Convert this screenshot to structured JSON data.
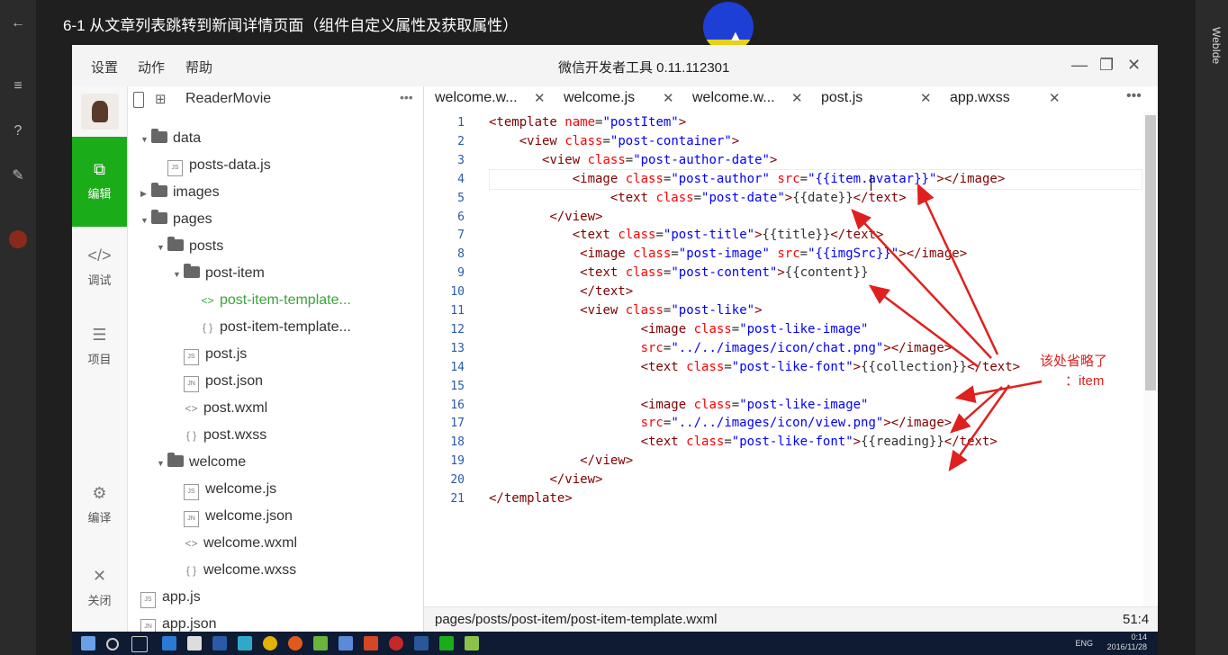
{
  "video": {
    "title": "6-1 从文章列表跳转到新闻详情页面（组件自定义属性及获取属性）",
    "right_panel_label": "WebIde"
  },
  "menubar": {
    "items": [
      "设置",
      "动作",
      "帮助"
    ],
    "window_title": "微信开发者工具 0.11.112301",
    "controls": [
      "—",
      "❐",
      "✕"
    ]
  },
  "iconbar": {
    "items": [
      {
        "icon": "edit-icon",
        "glyph": "⧉",
        "label": "编辑"
      },
      {
        "icon": "debug-icon",
        "glyph": "</>",
        "label": "调试"
      },
      {
        "icon": "project-icon",
        "glyph": "☰",
        "label": "项目"
      },
      {
        "icon": "compile-icon",
        "glyph": "⚙",
        "label": "编译"
      },
      {
        "icon": "close-icon",
        "glyph": "✕",
        "label": "关闭"
      }
    ]
  },
  "tree": {
    "project": "ReaderMovie",
    "nodes": [
      {
        "type": "folder",
        "label": "data",
        "open": true
      },
      {
        "type": "file",
        "tag": "JS",
        "label": "posts-data.js"
      },
      {
        "type": "folder",
        "label": "images",
        "open": false
      },
      {
        "type": "folder",
        "label": "pages",
        "open": true
      },
      {
        "type": "folder",
        "label": "posts",
        "open": true
      },
      {
        "type": "folder",
        "label": "post-item",
        "open": true
      },
      {
        "type": "wxml",
        "sym": "<>",
        "label": "post-item-template..."
      },
      {
        "type": "wxss",
        "sym": "{ }",
        "label": "post-item-template..."
      },
      {
        "type": "file",
        "tag": "JS",
        "label": "post.js"
      },
      {
        "type": "file",
        "tag": "JN",
        "label": "post.json"
      },
      {
        "type": "wxml",
        "sym": "<>",
        "label": "post.wxml"
      },
      {
        "type": "wxss",
        "sym": "{ }",
        "label": "post.wxss"
      },
      {
        "type": "folder",
        "label": "welcome",
        "open": true
      },
      {
        "type": "file",
        "tag": "JS",
        "label": "welcome.js"
      },
      {
        "type": "file",
        "tag": "JN",
        "label": "welcome.json"
      },
      {
        "type": "wxml",
        "sym": "<>",
        "label": "welcome.wxml"
      },
      {
        "type": "wxss",
        "sym": "{ }",
        "label": "welcome.wxss"
      },
      {
        "type": "file",
        "tag": "JS",
        "label": "app.js"
      },
      {
        "type": "file",
        "tag": "JN",
        "label": "app.json"
      }
    ]
  },
  "tabs": [
    "welcome.w...",
    "welcome.js",
    "welcome.w...",
    "post.js",
    "app.wxss"
  ],
  "code": [
    "<template name=\"postItem\">",
    "    <view class=\"post-container\">",
    "       <view class=\"post-author-date\">",
    "           <image class=\"post-author\" src=\"{{item.avatar}}\"></image>",
    "                <text class=\"post-date\">{{date}}</text>",
    "        </view>",
    "           <text class=\"post-title\">{{title}}</text>",
    "            <image class=\"post-image\" src=\"{{imgSrc}}\"></image>",
    "            <text class=\"post-content\">{{content}}",
    "            </text>",
    "            <view class=\"post-like\">",
    "                    <image class=\"post-like-image\"",
    "                    src=\"../../images/icon/chat.png\"></image>",
    "                    <text class=\"post-like-font\">{{collection}}</text>",
    "",
    "                    <image class=\"post-like-image\"",
    "                    src=\"../../images/icon/view.png\"></image>",
    "                    <text class=\"post-like-font\">{{reading}}</text>",
    "            </view>",
    "        </view>",
    "</template>"
  ],
  "annotation": {
    "line1": "该处省略了",
    "line2": "：item"
  },
  "statusbar": {
    "path": "pages/posts/post-item/post-item-template.wxml",
    "position": "51:4"
  },
  "taskbar": {
    "lang": "ENG",
    "time": "0:14",
    "date": "2016/11/28"
  },
  "colors": {
    "accent": "#1aad19",
    "tag": "#800000",
    "attr": "#ff0000",
    "value": "#0000ff",
    "annotation": "#e02020"
  }
}
